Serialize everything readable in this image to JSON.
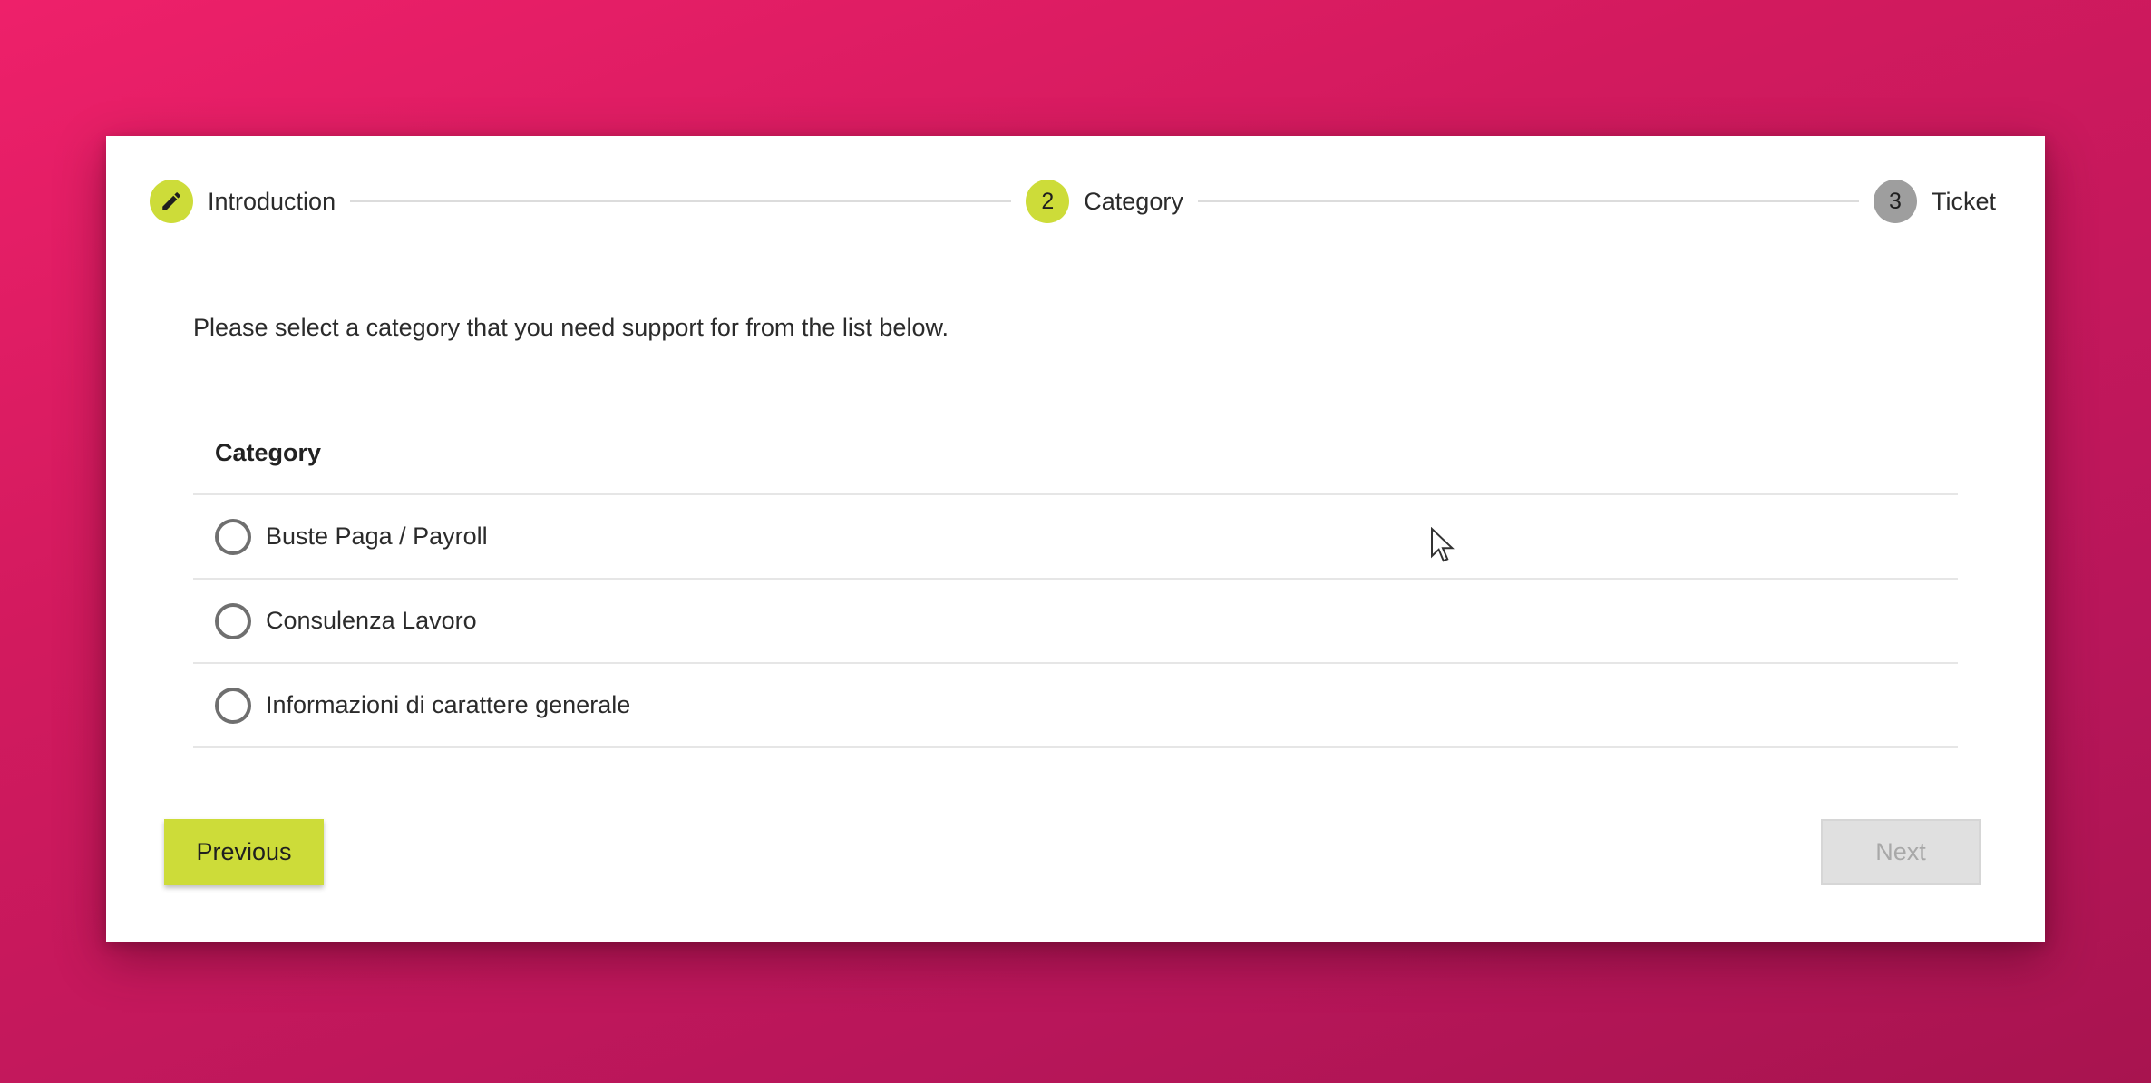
{
  "stepper": {
    "steps": [
      {
        "label": "Introduction",
        "marker": "",
        "icon": "pencil-icon",
        "state": "completed"
      },
      {
        "label": "Category",
        "marker": "2",
        "state": "active"
      },
      {
        "label": "Ticket",
        "marker": "3",
        "state": "inactive"
      }
    ]
  },
  "instruction": "Please select a category that you need support for from the list below.",
  "table": {
    "header": "Category",
    "rows": [
      {
        "label": "Buste Paga / Payroll",
        "selected": false
      },
      {
        "label": "Consulenza Lavoro",
        "selected": false
      },
      {
        "label": "Informazioni di carattere generale",
        "selected": false
      }
    ]
  },
  "buttons": {
    "previous": "Previous",
    "next": "Next"
  },
  "colors": {
    "accent": "#cddc39",
    "background": "#d21a5e",
    "inactive_step": "#9e9e9e",
    "disabled_button": "#e0e0e0"
  }
}
